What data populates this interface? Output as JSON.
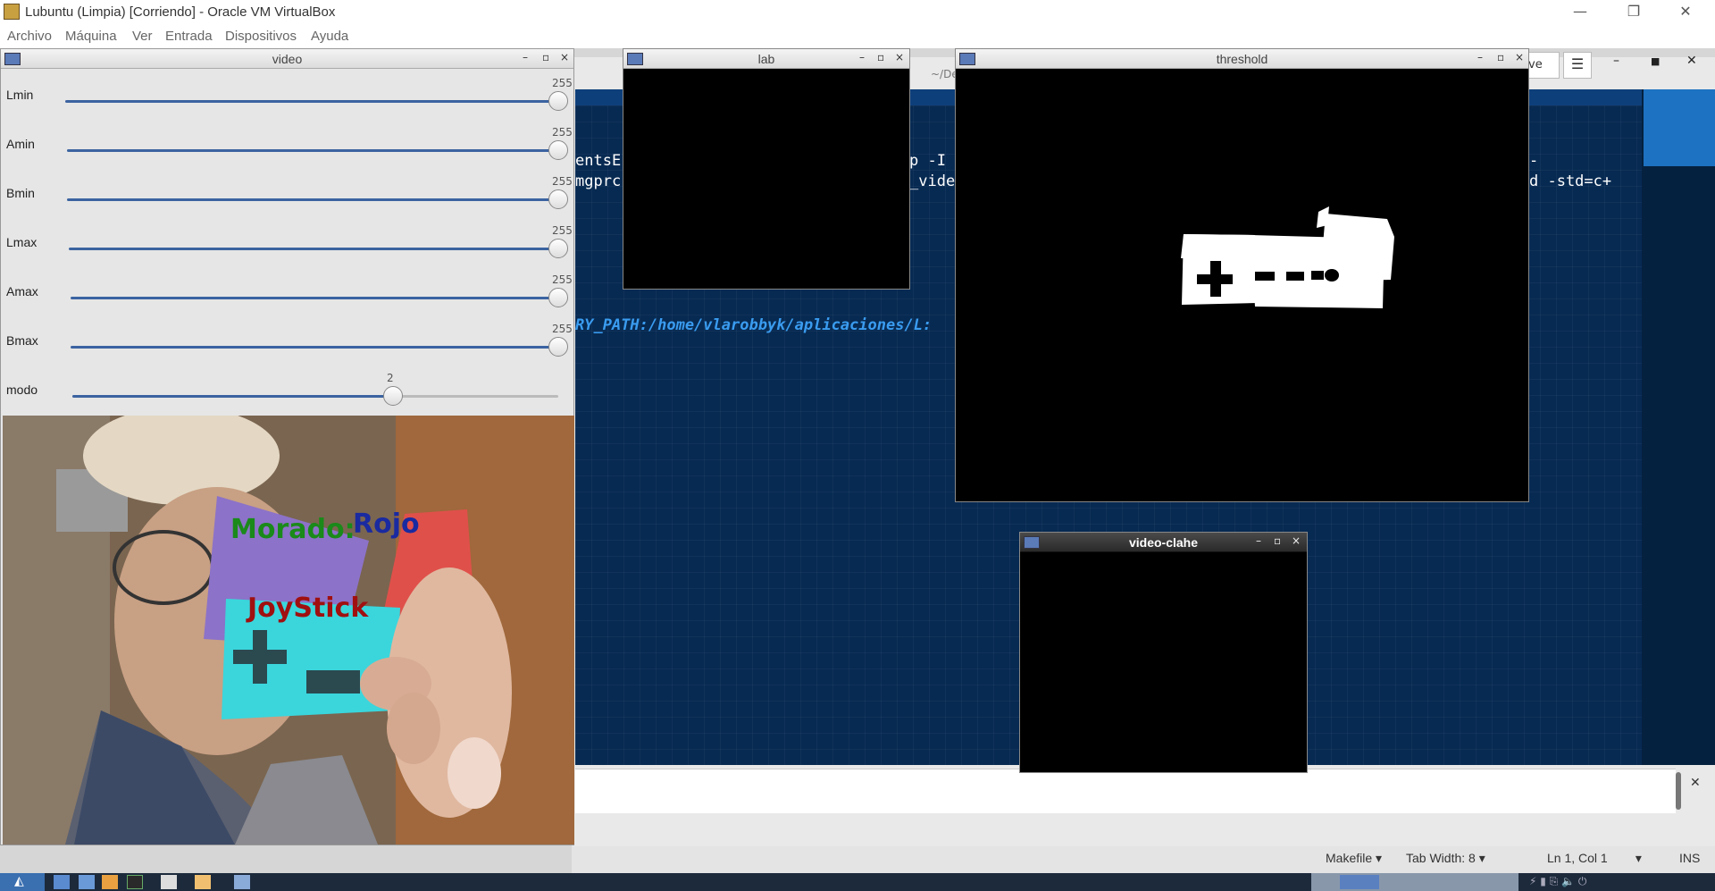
{
  "host": {
    "title": "Lubuntu (Limpia) [Corriendo] - Oracle VM VirtualBox",
    "menu": [
      "Archivo",
      "Máquina",
      "Ver",
      "Entrada",
      "Dispositivos",
      "Ayuda"
    ],
    "controls": {
      "minimize": "—",
      "restore": "❐",
      "close": "✕"
    }
  },
  "editor": {
    "path": "~/De",
    "btn_ve": "ve",
    "btn_menu": "☰",
    "ctl_min": "–",
    "ctl_max": "■",
    "ctl_close": "✕",
    "code_lines": [
      {
        "left": "entsE",
        "mid": "p -I",
        "right": "-"
      },
      {
        "left": "mgprc",
        "mid": "_vide",
        "right": "d -std=c+"
      }
    ],
    "path_line": "RY_PATH:/home/vlarobbyk/aplicaciones/L:",
    "lower_close": "✕",
    "status": {
      "filetype": "Makefile",
      "tabwidth": "Tab Width: 8",
      "position": "Ln 1, Col 1",
      "mode": "INS"
    }
  },
  "windows": {
    "video": {
      "title": "video",
      "trackbars": [
        {
          "label": "Lmin",
          "value": "255",
          "level": 1.0
        },
        {
          "label": "Amin",
          "value": "255",
          "level": 1.0
        },
        {
          "label": "Bmin",
          "value": "255",
          "level": 1.0
        },
        {
          "label": "Lmax",
          "value": "255",
          "level": 1.0
        },
        {
          "label": "Amax",
          "value": "255",
          "level": 1.0
        },
        {
          "label": "Bmax",
          "value": "255",
          "level": 1.0
        },
        {
          "label": "modo",
          "value": "2",
          "level": 0.66
        }
      ],
      "overlay": {
        "morado": "Morado:",
        "rojo": "Rojo",
        "joystick": "JoyStick"
      }
    },
    "lab": {
      "title": "lab"
    },
    "threshold": {
      "title": "threshold"
    },
    "clahe": {
      "title": "video-clahe"
    }
  },
  "win_controls": {
    "min": "–",
    "max": "▫",
    "close": "×"
  },
  "colors": {
    "terminal_bg": "#072a52",
    "path_blue": "#3a9cf0",
    "morado_text": "#1a8a1a",
    "rojo_text": "#1a2aa0",
    "joystick_text": "#a01010"
  }
}
